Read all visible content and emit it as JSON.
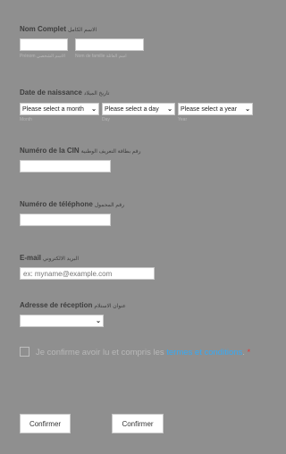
{
  "full_name": {
    "label": "Nom Complet",
    "label_ar": "الاسم الكامل",
    "first_hint": "Prénom",
    "first_hint_ar": "الاسم الشخصي",
    "last_hint": "Nom de famille",
    "last_hint_ar": "اسم العائلة"
  },
  "birth_date": {
    "label": "Date de naissance",
    "label_ar": "تاريخ الميلاد",
    "month_value": "Please select a month",
    "day_value": "Please select a day",
    "year_value": "Please select a year",
    "month_hint": "Month",
    "day_hint": "Day",
    "year_hint": "Year"
  },
  "cin": {
    "label": "Numéro de la CIN",
    "label_ar": "رقم بطاقة التعريف الوطنية"
  },
  "phone": {
    "label": "Numéro de téléphone",
    "label_ar": "رقم المحمول"
  },
  "email": {
    "label": "E-mail",
    "label_ar": "البريد الالكتروني",
    "placeholder": "ex: myname@example.com"
  },
  "address": {
    "label": "Adresse de réception",
    "label_ar": "عنوان الاستلام",
    "value": ""
  },
  "terms": {
    "text": "Je confirme avoir lu et compris les ",
    "link": "termes et conditions",
    "suffix": ".",
    "required_mark": "*"
  },
  "buttons": {
    "confirm_left": "Confirmer",
    "confirm_right": "Confirmer"
  }
}
